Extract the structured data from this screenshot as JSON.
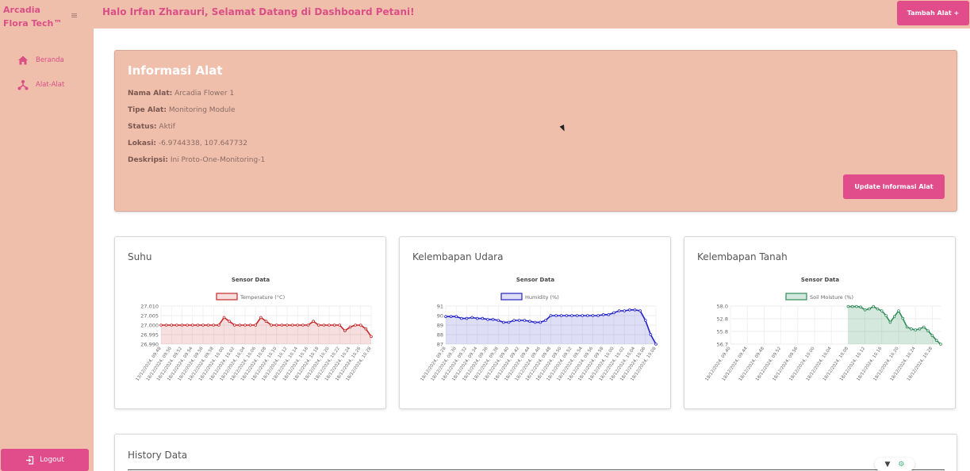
{
  "sidebar": {
    "brand": [
      "Arcadia",
      "Flora Tech™"
    ],
    "menu_icon": "hamburger-icon",
    "items": [
      {
        "label": "Beranda",
        "icon": "home-icon"
      },
      {
        "label": "Alat-Alat",
        "icon": "network-icon"
      }
    ],
    "logout_label": "Logout"
  },
  "header": {
    "welcome": "Halo Irfan Zharauri, Selamat Datang di Dashboard Petani!",
    "add_button": "Tambah Alat +"
  },
  "info": {
    "title": "Informasi Alat",
    "rows": [
      {
        "label": "Nama Alat:",
        "value": "Arcadia Flower 1"
      },
      {
        "label": "Tipe Alat:",
        "value": "Monitoring Module"
      },
      {
        "label": "Status:",
        "value": "Aktif"
      },
      {
        "label": "Lokasi:",
        "value": "-6.9744338, 107.647732"
      },
      {
        "label": "Deskripsi:",
        "value": "Ini Proto-One-Monitoring-1"
      }
    ],
    "update_button": "Update Informasi Alat"
  },
  "colors": {
    "accent": "#e14c8b",
    "panel": "#efbfac",
    "temperature": "#c62828",
    "humidity": "#2323c8",
    "soil": "#2e8b57"
  },
  "chart_data": [
    {
      "type": "line",
      "card_title": "Suhu",
      "title": "Sensor Data",
      "legend": "Temperature (°C)",
      "yticks": [
        "27.010",
        "27.005",
        "27.000",
        "26.995",
        "26.990"
      ],
      "ylim": [
        26.99,
        27.01
      ],
      "x": [
        "13/12/2024, 09.48",
        "18/12/2024, 09.49",
        "18/12/2024, 09.50",
        "18/12/2024, 09.51",
        "18/12/2024, 09.52",
        "18/12/2024, 09.53",
        "18/12/2024, 09.54",
        "18/12/2024, 09.55",
        "18/12/2024, 09.56",
        "18/12/2024, 09.57",
        "18/12/2024, 09.58",
        "18/12/2024, 09.59",
        "18/12/2024, 10.00",
        "18/12/2024, 10.01",
        "18/12/2024, 10.02",
        "18/12/2024, 10.03",
        "18/12/2024, 10.04",
        "18/12/2024, 10.05",
        "18/12/2024, 10.06",
        "18/12/2024, 10.07",
        "18/12/2024, 10.08",
        "18/12/2024, 10.09",
        "18/12/2024, 10.10",
        "18/12/2024, 10.11",
        "18/12/2024, 10.12",
        "18/12/2024, 10.13",
        "18/12/2024, 10.14",
        "18/12/2024, 10.15",
        "18/12/2024, 10.16",
        "18/12/2024, 10.17",
        "18/12/2024, 10.18",
        "18/12/2024, 10.19",
        "18/12/2024, 10.20",
        "18/12/2024, 10.21",
        "18/12/2024, 10.22",
        "18/12/2024, 10.23",
        "18/12/2024, 10.24",
        "18/12/2024, 10.25",
        "18/12/2024, 10.26",
        "18/12/2024, 10.27",
        "18/12/2024, 10.28"
      ],
      "xticks": [
        "13/12/2024, 09.48",
        "18/12/2024, 09.50",
        "18/12/2024, 09.52",
        "18/12/2024, 09.54",
        "18/12/2024, 09.56",
        "18/12/2024, 09.58",
        "18/12/2024, 10.00",
        "18/12/2024, 10.02",
        "18/12/2024, 10.04",
        "18/12/2024, 10.06",
        "18/12/2024, 10.08",
        "18/12/2024, 10.10",
        "18/12/2024, 10.12",
        "18/12/2024, 10.14",
        "18/12/2024, 10.16",
        "18/12/2024, 10.18",
        "18/12/2024, 10.20",
        "18/12/2024, 10.22",
        "18/12/2024, 10.24",
        "18/12/2024, 10.26",
        "18/12/2024, 10.28"
      ],
      "values": [
        27.0,
        27.0,
        27.0,
        27.0,
        27.0,
        27.0,
        27.0,
        27.0,
        27.0,
        27.0,
        27.0,
        27.0,
        27.004,
        27.002,
        27.0,
        27.0,
        27.0,
        27.0,
        27.0,
        27.004,
        27.002,
        27.0,
        27.0,
        27.0,
        27.0,
        27.0,
        27.0,
        27.0,
        27.0,
        27.002,
        27.0,
        27.0,
        27.0,
        27.0,
        27.0,
        26.997,
        26.999,
        27.0,
        27.0,
        26.998,
        26.994
      ]
    },
    {
      "type": "line",
      "card_title": "Kelembapan Udara",
      "title": "Sensor Data",
      "legend": "Humidity (%)",
      "yticks": [
        "91",
        "90",
        "89",
        "88",
        "87"
      ],
      "ylim": [
        87,
        91
      ],
      "x": [
        "18/12/2024, 09.28",
        "18/12/2024, 09.29",
        "18/12/2024, 09.30",
        "18/12/2024, 09.31",
        "18/12/2024, 09.32",
        "18/12/2024, 09.33",
        "18/12/2024, 09.34",
        "18/12/2024, 09.35",
        "18/12/2024, 09.36",
        "18/12/2024, 09.37",
        "18/12/2024, 09.38",
        "18/12/2024, 09.39",
        "18/12/2024, 09.40",
        "18/12/2024, 09.41",
        "18/12/2024, 09.42",
        "18/12/2024, 09.43",
        "18/12/2024, 09.44",
        "18/12/2024, 09.45",
        "18/12/2024, 09.46",
        "18/12/2024, 09.47",
        "18/12/2024, 09.48",
        "18/12/2024, 09.49",
        "18/12/2024, 09.50",
        "18/12/2024, 09.51",
        "18/12/2024, 09.52",
        "18/12/2024, 09.53",
        "18/12/2024, 09.54",
        "18/12/2024, 09.55",
        "18/12/2024, 09.56",
        "18/12/2024, 09.57",
        "18/12/2024, 09.58",
        "18/12/2024, 09.59",
        "18/12/2024, 10.00",
        "18/12/2024, 10.01",
        "18/12/2024, 10.02",
        "18/12/2024, 10.03",
        "18/12/2024, 10.04",
        "18/12/2024, 10.05",
        "18/12/2024, 10.06",
        "18/12/2024, 10.07",
        "18/12/2024, 10.08"
      ],
      "xticks": [
        "18/12/2024, 09.28",
        "18/12/2024, 09.30",
        "18/12/2024, 09.32",
        "18/12/2024, 09.34",
        "18/12/2024, 09.36",
        "18/12/2024, 09.38",
        "18/12/2024, 09.40",
        "18/12/2024, 09.42",
        "18/12/2024, 09.44",
        "18/12/2024, 09.46",
        "18/12/2024, 09.48",
        "18/12/2024, 09.50",
        "18/12/2024, 09.52",
        "18/12/2024, 09.54",
        "18/12/2024, 09.56",
        "18/12/2024, 09.58",
        "18/12/2024, 10.00",
        "18/12/2024, 10.02",
        "18/12/2024, 10.04",
        "18/12/2024, 10.06",
        "18/12/2024, 10.08"
      ],
      "values": [
        89.9,
        89.9,
        89.9,
        89.7,
        89.7,
        89.8,
        89.7,
        89.7,
        89.6,
        89.6,
        89.5,
        89.3,
        89.3,
        89.5,
        89.5,
        89.5,
        89.4,
        89.3,
        89.3,
        89.5,
        90.0,
        90.0,
        90.0,
        90.0,
        90.0,
        90.0,
        90.0,
        90.0,
        90.0,
        90.0,
        90.1,
        90.1,
        90.3,
        90.5,
        90.5,
        90.6,
        90.6,
        90.5,
        89.5,
        88.0,
        87.0
      ]
    },
    {
      "type": "line",
      "card_title": "Kelembapan Tanah",
      "title": "Sensor Data",
      "legend": "Soil Moisture (%)",
      "yticks": [
        "58.0",
        "52.8",
        "55.8",
        "56.7"
      ],
      "ylim": [
        0,
        4
      ],
      "x": [
        "18/12/2024, 09.40",
        "18/12/2024, 09.41",
        "18/12/2024, 09.42",
        "18/12/2024, 09.43",
        "18/12/2024, 09.44",
        "18/12/2024, 09.45",
        "18/12/2024, 09.46",
        "18/12/2024, 09.47",
        "18/12/2024, 09.48",
        "18/12/2024, 09.49",
        "18/12/2024, 09.50",
        "18/12/2024, 09.51",
        "18/12/2024, 09.52",
        "18/12/2024, 09.53",
        "18/12/2024, 09.54",
        "18/12/2024, 09.55",
        "18/12/2024, 09.56",
        "18/12/2024, 09.57",
        "18/12/2024, 09.58",
        "18/12/2024, 09.59",
        "18/12/2024, 10.00",
        "18/12/2024, 10.01",
        "18/12/2024, 10.02",
        "18/12/2024, 10.03",
        "18/12/2024, 10.04",
        "18/12/2024, 10.05",
        "18/12/2024, 10.06",
        "18/12/2024, 10.07",
        "18/12/2024, 10.08",
        "18/12/2024, 10.09",
        "18/12/2024, 10.10",
        "18/12/2024, 10.11",
        "18/12/2024, 10.12",
        "18/12/2024, 10.13",
        "18/12/2024, 10.14",
        "18/12/2024, 10.15",
        "18/12/2024, 10.16",
        "18/12/2024, 10.17",
        "18/12/2024, 10.18",
        "18/12/2024, 10.19",
        "18/12/2024, 10.20",
        "18/12/2024, 10.21",
        "18/12/2024, 10.22",
        "18/12/2024, 10.23",
        "18/12/2024, 10.24",
        "18/12/2024, 10.25",
        "18/12/2024, 10.26",
        "18/12/2024, 10.27",
        "18/12/2024, 10.28",
        "18/12/2024, 10.29",
        "18/12/2024, 10.30"
      ],
      "xticks": [
        "18/12/2024, 09.40",
        "18/12/2024, 09.44",
        "18/12/2024, 09.48",
        "18/12/2024, 09.52",
        "18/12/2024, 09.56",
        "18/12/2024, 10.00",
        "18/12/2024, 10.04",
        "18/12/2024, 10.08",
        "18/12/2024, 10.12",
        "18/12/2024, 10.16",
        "18/12/2024, 10.20",
        "18/12/2024, 10.24",
        "18/12/2024, 10.28"
      ],
      "values": [
        null,
        null,
        null,
        null,
        null,
        null,
        null,
        null,
        null,
        null,
        null,
        null,
        null,
        null,
        null,
        null,
        null,
        null,
        null,
        null,
        null,
        null,
        null,
        null,
        null,
        null,
        null,
        null,
        3.95,
        3.95,
        3.95,
        3.9,
        3.6,
        3.7,
        3.95,
        3.7,
        3.5,
        3.0,
        2.3,
        2.9,
        3.5,
        2.7,
        1.8,
        1.6,
        1.5,
        1.6,
        1.8,
        1.4,
        0.9,
        0.4,
        0.0
      ]
    }
  ]
}
